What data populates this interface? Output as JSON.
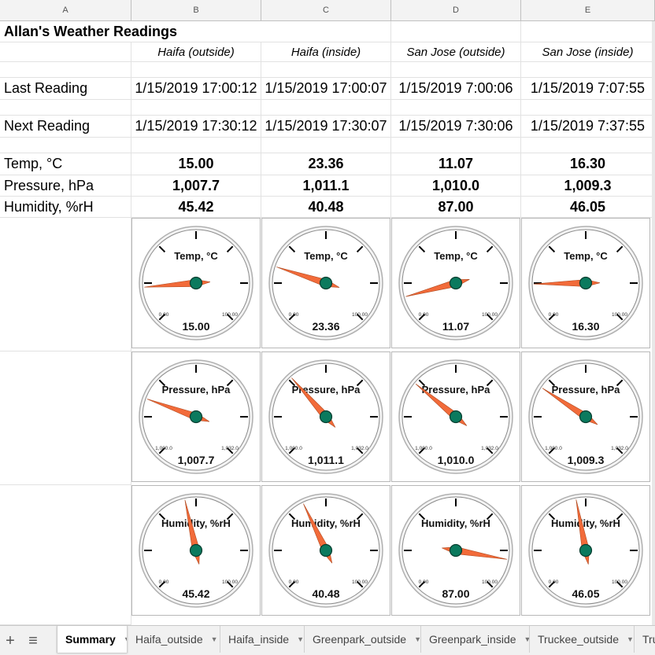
{
  "columns": [
    "A",
    "B",
    "C",
    "D",
    "E"
  ],
  "sheet_title": "Allan's Weather Readings",
  "locations": [
    "Haifa (outside)",
    "Haifa (inside)",
    "San Jose (outside)",
    "San Jose (inside)"
  ],
  "row_labels": {
    "last_reading": "Last Reading",
    "next_reading": "Next Reading",
    "temp": "Temp, °C",
    "pressure": "Pressure, hPa",
    "humidity": "Humidity, %rH"
  },
  "last_reading": [
    "1/15/2019 17:00:12",
    "1/15/2019 17:00:07",
    "1/15/2019 7:00:06",
    "1/15/2019 7:07:55"
  ],
  "next_reading": [
    "1/15/2019 17:30:12",
    "1/15/2019 17:30:07",
    "1/15/2019 7:30:06",
    "1/15/2019 7:37:55"
  ],
  "temp": [
    "15.00",
    "23.36",
    "11.07",
    "16.30"
  ],
  "pressure": [
    "1,007.7",
    "1,011.1",
    "1,010.0",
    "1,009.3"
  ],
  "humidity": [
    "45.42",
    "40.48",
    "87.00",
    "46.05"
  ],
  "gauges": {
    "temp": {
      "title": "Temp, °C",
      "min_label": "0.00",
      "max_label": "100.00",
      "min": 0,
      "max": 100,
      "values": [
        15.0,
        23.36,
        11.07,
        16.3
      ],
      "labels": [
        "15.00",
        "23.36",
        "11.07",
        "16.30"
      ]
    },
    "pressure": {
      "title": "Pressure, hPa",
      "min_label": "1,000.0",
      "max_label": "1,032.0",
      "min": 1000,
      "max": 1032,
      "values": [
        1007.7,
        1011.1,
        1010.0,
        1009.3
      ],
      "labels": [
        "1,007.7",
        "1,011.1",
        "1,010.0",
        "1,009.3"
      ]
    },
    "humidity": {
      "title": "Humidity, %rH",
      "min_label": "0.00",
      "max_label": "100.00",
      "min": 0,
      "max": 100,
      "values": [
        45.42,
        40.48,
        87.0,
        46.05
      ],
      "labels": [
        "45.42",
        "40.48",
        "87.00",
        "46.05"
      ]
    }
  },
  "colors": {
    "needle": "#f26b3a",
    "hub": "#0b7a5e",
    "dial_ring": "#9a9a9a"
  },
  "sheet_tabs": {
    "add_icon": "plus-icon",
    "all_sheets_icon": "menu-icon",
    "tabs": [
      "Summary",
      "Haifa_outside",
      "Haifa_inside",
      "Greenpark_outside",
      "Greenpark_inside",
      "Truckee_outside",
      "Tru"
    ],
    "active": "Summary"
  }
}
